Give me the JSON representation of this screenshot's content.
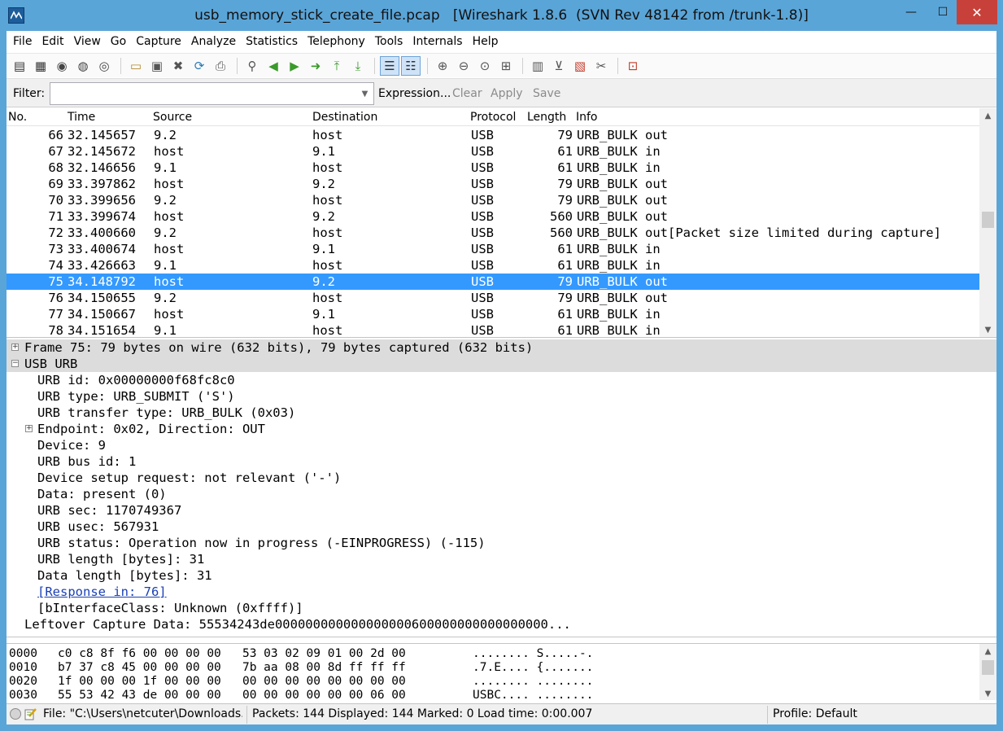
{
  "window": {
    "title": "usb_memory_stick_create_file.pcap   [Wireshark 1.8.6  (SVN Rev 48142 from /trunk-1.8)]",
    "minimize_glyph": "—",
    "maximize_glyph": "☐",
    "close_glyph": "✕"
  },
  "menu": [
    "File",
    "Edit",
    "View",
    "Go",
    "Capture",
    "Analyze",
    "Statistics",
    "Telephony",
    "Tools",
    "Internals",
    "Help"
  ],
  "toolbar": {
    "icons": [
      "interface-list-icon",
      "capture-options-icon",
      "start-capture-icon",
      "stop-capture-icon",
      "restart-capture-icon",
      "open-file-icon",
      "save-file-icon",
      "close-file-icon",
      "reload-icon",
      "print-icon",
      "find-packet-icon",
      "go-back-icon",
      "go-forward-icon",
      "go-to-packet-icon",
      "go-first-icon",
      "go-last-icon",
      "colorize-icon",
      "autoscroll-icon",
      "zoom-in-icon",
      "zoom-out-icon",
      "zoom-normal-icon",
      "resize-columns-icon",
      "capture-filters-icon",
      "display-filters-icon",
      "coloring-rules-icon",
      "preferences-icon",
      "help-icon"
    ]
  },
  "filter": {
    "label": "Filter:",
    "value": "",
    "expression_label": "Expression...",
    "clear_label": "Clear",
    "apply_label": "Apply",
    "save_label": "Save"
  },
  "packet_list": {
    "columns": [
      "No.",
      "Time",
      "Source",
      "Destination",
      "Protocol",
      "Length",
      "Info"
    ],
    "rows": [
      {
        "no": "66",
        "time": "32.145657",
        "src": "9.2",
        "dst": "host",
        "proto": "USB",
        "len": "79",
        "info": "URB_BULK out"
      },
      {
        "no": "67",
        "time": "32.145672",
        "src": "host",
        "dst": "9.1",
        "proto": "USB",
        "len": "61",
        "info": "URB_BULK in"
      },
      {
        "no": "68",
        "time": "32.146656",
        "src": "9.1",
        "dst": "host",
        "proto": "USB",
        "len": "61",
        "info": "URB_BULK in"
      },
      {
        "no": "69",
        "time": "33.397862",
        "src": "host",
        "dst": "9.2",
        "proto": "USB",
        "len": "79",
        "info": "URB_BULK out"
      },
      {
        "no": "70",
        "time": "33.399656",
        "src": "9.2",
        "dst": "host",
        "proto": "USB",
        "len": "79",
        "info": "URB_BULK out"
      },
      {
        "no": "71",
        "time": "33.399674",
        "src": "host",
        "dst": "9.2",
        "proto": "USB",
        "len": "560",
        "info": "URB_BULK out"
      },
      {
        "no": "72",
        "time": "33.400660",
        "src": "9.2",
        "dst": "host",
        "proto": "USB",
        "len": "560",
        "info": "URB_BULK out[Packet size limited during capture]"
      },
      {
        "no": "73",
        "time": "33.400674",
        "src": "host",
        "dst": "9.1",
        "proto": "USB",
        "len": "61",
        "info": "URB_BULK in"
      },
      {
        "no": "74",
        "time": "33.426663",
        "src": "9.1",
        "dst": "host",
        "proto": "USB",
        "len": "61",
        "info": "URB_BULK in"
      },
      {
        "no": "75",
        "time": "34.148792",
        "src": "host",
        "dst": "9.2",
        "proto": "USB",
        "len": "79",
        "info": "URB_BULK out",
        "selected": true
      },
      {
        "no": "76",
        "time": "34.150655",
        "src": "9.2",
        "dst": "host",
        "proto": "USB",
        "len": "79",
        "info": "URB_BULK out"
      },
      {
        "no": "77",
        "time": "34.150667",
        "src": "host",
        "dst": "9.1",
        "proto": "USB",
        "len": "61",
        "info": "URB_BULK in"
      },
      {
        "no": "78",
        "time": "34.151654",
        "src": "9.1",
        "dst": "host",
        "proto": "USB",
        "len": "61",
        "info": "URB_BULK in"
      }
    ]
  },
  "details": {
    "rows": [
      {
        "text": "Frame 75: 79 bytes on wire (632 bits), 79 bytes captured (632 bits)",
        "indent": 0,
        "expander": "+",
        "hl": true
      },
      {
        "text": "USB URB",
        "indent": 0,
        "expander": "−",
        "hl": true
      },
      {
        "text": "URB id: 0x00000000f68fc8c0",
        "indent": 1
      },
      {
        "text": "URB type: URB_SUBMIT ('S')",
        "indent": 1
      },
      {
        "text": "URB transfer type: URB_BULK (0x03)",
        "indent": 1
      },
      {
        "text": "Endpoint: 0x02, Direction: OUT",
        "indent": 1,
        "expander": "+"
      },
      {
        "text": "Device: 9",
        "indent": 1
      },
      {
        "text": "URB bus id: 1",
        "indent": 1
      },
      {
        "text": "Device setup request: not relevant ('-')",
        "indent": 1
      },
      {
        "text": "Data: present (0)",
        "indent": 1
      },
      {
        "text": "URB sec: 1170749367",
        "indent": 1
      },
      {
        "text": "URB usec: 567931",
        "indent": 1
      },
      {
        "text": "URB status: Operation now in progress (-EINPROGRESS) (-115)",
        "indent": 1
      },
      {
        "text": "URB length [bytes]: 31",
        "indent": 1
      },
      {
        "text": "Data length [bytes]: 31",
        "indent": 1
      },
      {
        "text": "[Response in: 76]",
        "indent": 1,
        "link": true
      },
      {
        "text": "[bInterfaceClass: Unknown (0xffff)]",
        "indent": 1
      },
      {
        "text": "Leftover Capture Data: 55534243de000000000000000000600000000000000000...",
        "indent": 0
      }
    ]
  },
  "bytes": {
    "rows": [
      {
        "offset": "0000",
        "hex": "c0 c8 8f f6 00 00 00 00   53 03 02 09 01 00 2d 00",
        "ascii": "........ S.....-."
      },
      {
        "offset": "0010",
        "hex": "b7 37 c8 45 00 00 00 00   7b aa 08 00 8d ff ff ff",
        "ascii": ".7.E.... {......."
      },
      {
        "offset": "0020",
        "hex": "1f 00 00 00 1f 00 00 00   00 00 00 00 00 00 00 00",
        "ascii": "........ ........"
      },
      {
        "offset": "0030",
        "hex": "55 53 42 43 de 00 00 00   00 00 00 00 00 00 06 00",
        "ascii": "USBC.... ........"
      }
    ]
  },
  "status": {
    "file": "File: \"C:\\Users\\netcuter\\Downloads...",
    "packets": "Packets: 144 Displayed: 144 Marked: 0 Load time: 0:00.007",
    "profile": "Profile: Default"
  },
  "colors": {
    "frame": "#5aa5d8",
    "selected_row": "#3399ff",
    "close_button": "#c7413a",
    "link": "#1a3fb5"
  }
}
